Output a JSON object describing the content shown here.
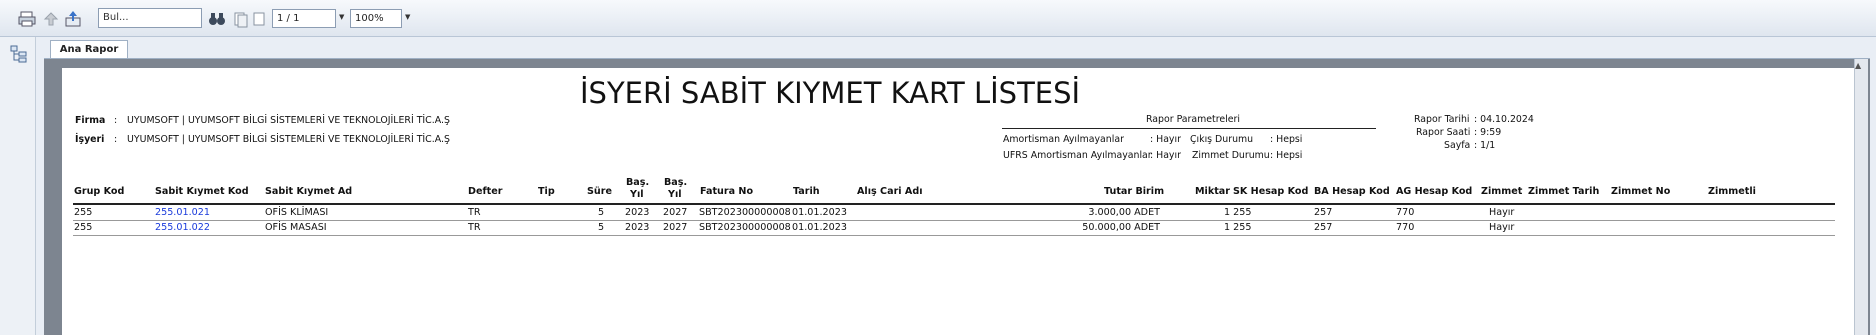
{
  "toolbar": {
    "find_placeholder": "Bul...",
    "page_value": "1 / 1",
    "zoom_value": "100%"
  },
  "tab": {
    "label": "Ana Rapor"
  },
  "report": {
    "title": "İSYERİ SABİT KIYMET KART LİSTESİ",
    "firma_label": "Firma",
    "firma_sep": ":",
    "firma_value": "UYUMSOFT | UYUMSOFT BİLGİ SİSTEMLERİ VE TEKNOLOJİLERİ TİC.A.Ş",
    "isyeri_label": "İşyeri",
    "isyeri_sep": ":",
    "isyeri_value": "UYUMSOFT | UYUMSOFT BİLGİ SİSTEMLERİ VE TEKNOLOJİLERİ TİC.A.Ş",
    "params_title": "Rapor Parametreleri",
    "params": {
      "amort_label": "Amortisman Ayılmayanlar",
      "amort_value": ": Hayır",
      "cikis_label": "Çıkış Durumu",
      "cikis_value": ": Hepsi",
      "ufrs_label": "UFRS Amortisman Ayılmayanlar",
      "ufrs_value": ": Hayır",
      "zimmet_label": "Zimmet Durumu",
      "zimmet_value": ": Hepsi"
    },
    "meta": {
      "tarih_label": "Rapor Tarihi",
      "tarih_value": ": 04.10.2024",
      "saat_label": "Rapor Saati",
      "saat_value": ": 9:59",
      "sayfa_label": "Sayfa",
      "sayfa_value": ": 1/1"
    },
    "columns": {
      "grup_kod": "Grup Kod",
      "sabit_kiymet_kod": "Sabit Kıymet Kod",
      "sabit_kiymet_ad": "Sabit Kıymet Ad",
      "defter": "Defter",
      "tip": "Tip",
      "sure": "Süre",
      "bas_yil_1_top": "Baş.",
      "bas_yil_1_bot": "Yıl",
      "bas_yil_2_top": "Baş.",
      "bas_yil_2_bot": "Yıl",
      "fatura_no": "Fatura No",
      "tarih": "Tarih",
      "alis_cari_adi": "Alış Cari Adı",
      "tutar_birim": "Tutar Birim",
      "miktar": "Miktar",
      "sk_hesap_kod": "SK Hesap Kod",
      "ba_hesap_kod": "BA Hesap Kod",
      "ag_hesap_kod": "AG Hesap Kod",
      "zimmet": "Zimmet",
      "zimmet_tarih": "Zimmet Tarih",
      "zimmet_no": "Zimmet No",
      "zimmetli": "Zimmetli"
    },
    "rows": [
      {
        "grup_kod": "255",
        "sabit_kiymet_kod": "255.01.021",
        "sabit_kiymet_ad": "OFİS KLİMASI",
        "defter": "TR",
        "sure": "5",
        "bas_yil_1": "2023",
        "bas_yil_2": "2027",
        "fatura_no": "SBT202300000008",
        "tarih": "01.01.2023",
        "tutar_birim": "3.000,00 ADET",
        "miktar_sk": "1 255",
        "ba_hesap_kod": "257",
        "ag_hesap_kod": "770",
        "zimmet": "Hayır"
      },
      {
        "grup_kod": "255",
        "sabit_kiymet_kod": "255.01.022",
        "sabit_kiymet_ad": "OFİS MASASI",
        "defter": "TR",
        "sure": "5",
        "bas_yil_1": "2023",
        "bas_yil_2": "2027",
        "fatura_no": "SBT202300000008",
        "tarih": "01.01.2023",
        "tutar_birim": "50.000,00 ADET",
        "miktar_sk": "1 255",
        "ba_hesap_kod": "257",
        "ag_hesap_kod": "770",
        "zimmet": "Hayır"
      }
    ]
  },
  "colors": {
    "link": "#1a3bdb",
    "frame": "#7d8590",
    "toolbar_border": "#b9c6d6"
  }
}
